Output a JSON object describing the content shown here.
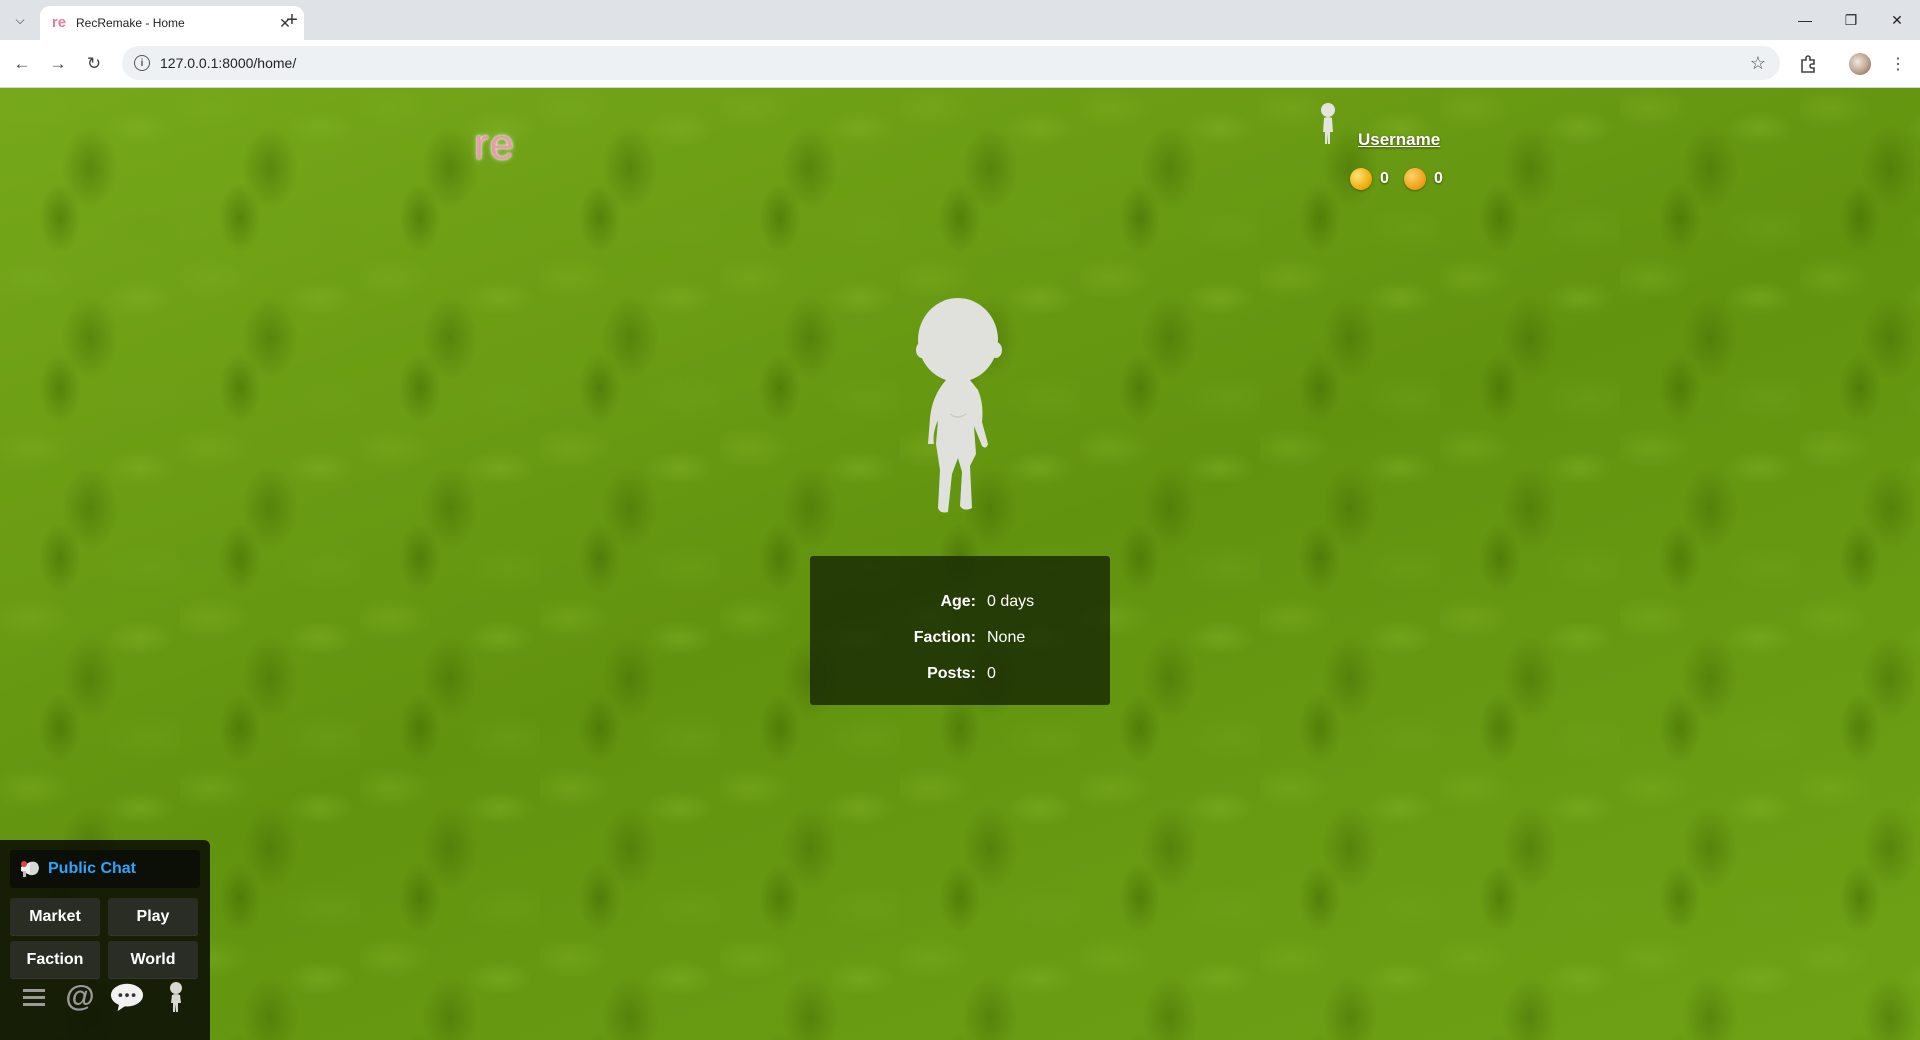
{
  "browser": {
    "tab_title": "RecRemake - Home",
    "favicon_text": "re",
    "url": "127.0.0.1:8000/home/"
  },
  "header": {
    "logo_text": "re",
    "username": "Username",
    "currency": [
      {
        "icon": "gold-coin-icon",
        "value": "0"
      },
      {
        "icon": "cookie-coin-icon",
        "value": "0"
      }
    ]
  },
  "profile": {
    "stats": [
      {
        "label": "Age:",
        "value": "0 days"
      },
      {
        "label": "Faction:",
        "value": "None"
      },
      {
        "label": "Posts:",
        "value": "0"
      }
    ]
  },
  "dock": {
    "chat_label": "Public Chat",
    "buttons": {
      "market": "Market",
      "play": "Play",
      "faction": "Faction",
      "world": "World"
    },
    "icons": [
      "menu-icon",
      "mentions-icon",
      "chat-bubble-icon",
      "avatar-icon"
    ]
  },
  "colors": {
    "background": "#6a9b12",
    "logo": "#e99ab0",
    "chat_link": "#2ea3ff",
    "panel": "#192805"
  }
}
